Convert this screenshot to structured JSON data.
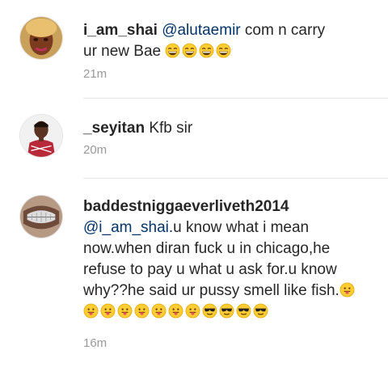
{
  "comments": [
    {
      "username": "i_am_shai",
      "mention": "@alutaemir",
      "text_before": " com n carry",
      "text_line2": "ur new Bae",
      "emojis": [
        "laughing-emoji",
        "laughing-emoji",
        "laughing-emoji",
        "laughing-emoji"
      ],
      "time": "21m"
    },
    {
      "username": "_seyitan",
      "text": " Kfb sir",
      "time": "20m"
    },
    {
      "username": "baddestniggaeverliveth2014",
      "mention": "@i_am_shai.",
      "text": "u know what i mean now.when diran fuck u in chicago,he refuse to pay u what u ask for.u know why??he said ur pussy smell like fish.",
      "emojis": [
        "tongue-out-emoji",
        "tongue-out-emoji",
        "tongue-out-emoji",
        "tongue-out-emoji",
        "tongue-out-emoji",
        "tongue-out-emoji",
        "tongue-out-emoji",
        "tongue-out-emoji",
        "sunglasses-emoji",
        "sunglasses-emoji",
        "sunglasses-emoji",
        "sunglasses-emoji"
      ],
      "time": "16m"
    }
  ]
}
